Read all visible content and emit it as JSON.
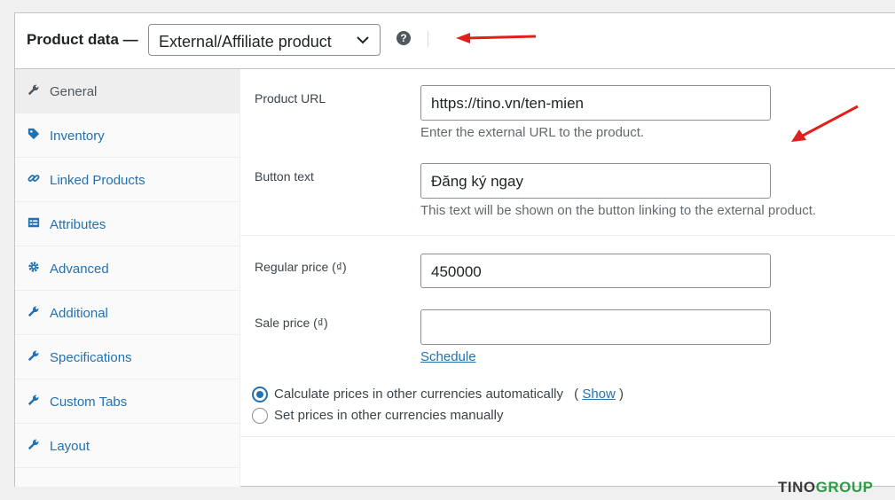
{
  "header": {
    "title": "Product data —",
    "product_type": "External/Affiliate product",
    "help": "?"
  },
  "tabs": [
    {
      "label": "General",
      "icon": "wrench-icon",
      "active": true
    },
    {
      "label": "Inventory",
      "icon": "tag-icon"
    },
    {
      "label": "Linked Products",
      "icon": "link-icon"
    },
    {
      "label": "Attributes",
      "icon": "list-icon"
    },
    {
      "label": "Advanced",
      "icon": "gear-icon"
    },
    {
      "label": "Additional",
      "icon": "wrench-icon"
    },
    {
      "label": "Specifications",
      "icon": "wrench-icon"
    },
    {
      "label": "Custom Tabs",
      "icon": "wrench-icon"
    },
    {
      "label": "Layout",
      "icon": "wrench-icon"
    }
  ],
  "general": {
    "product_url": {
      "label": "Product URL",
      "value": "https://tino.vn/ten-mien",
      "description": "Enter the external URL to the product."
    },
    "button_text": {
      "label": "Button text",
      "value": "Đăng ký ngay",
      "description": "This text will be shown on the button linking to the external product."
    },
    "regular_price": {
      "label": "Regular price (₫)",
      "value": "450000"
    },
    "sale_price": {
      "label": "Sale price (₫)",
      "value": ""
    },
    "schedule_link": "Schedule",
    "currency": {
      "auto_label": "Calculate prices in other currencies automatically",
      "show_open": "(",
      "show_link": "Show",
      "show_close": ")",
      "manual_label": "Set prices in other currencies manually"
    }
  },
  "brand": {
    "part1": "TINO",
    "part2": "GR",
    "part3": "UP"
  },
  "colors": {
    "accent": "#2271b1",
    "arrow": "#e0201b",
    "brand_green": "#2e9c46"
  }
}
